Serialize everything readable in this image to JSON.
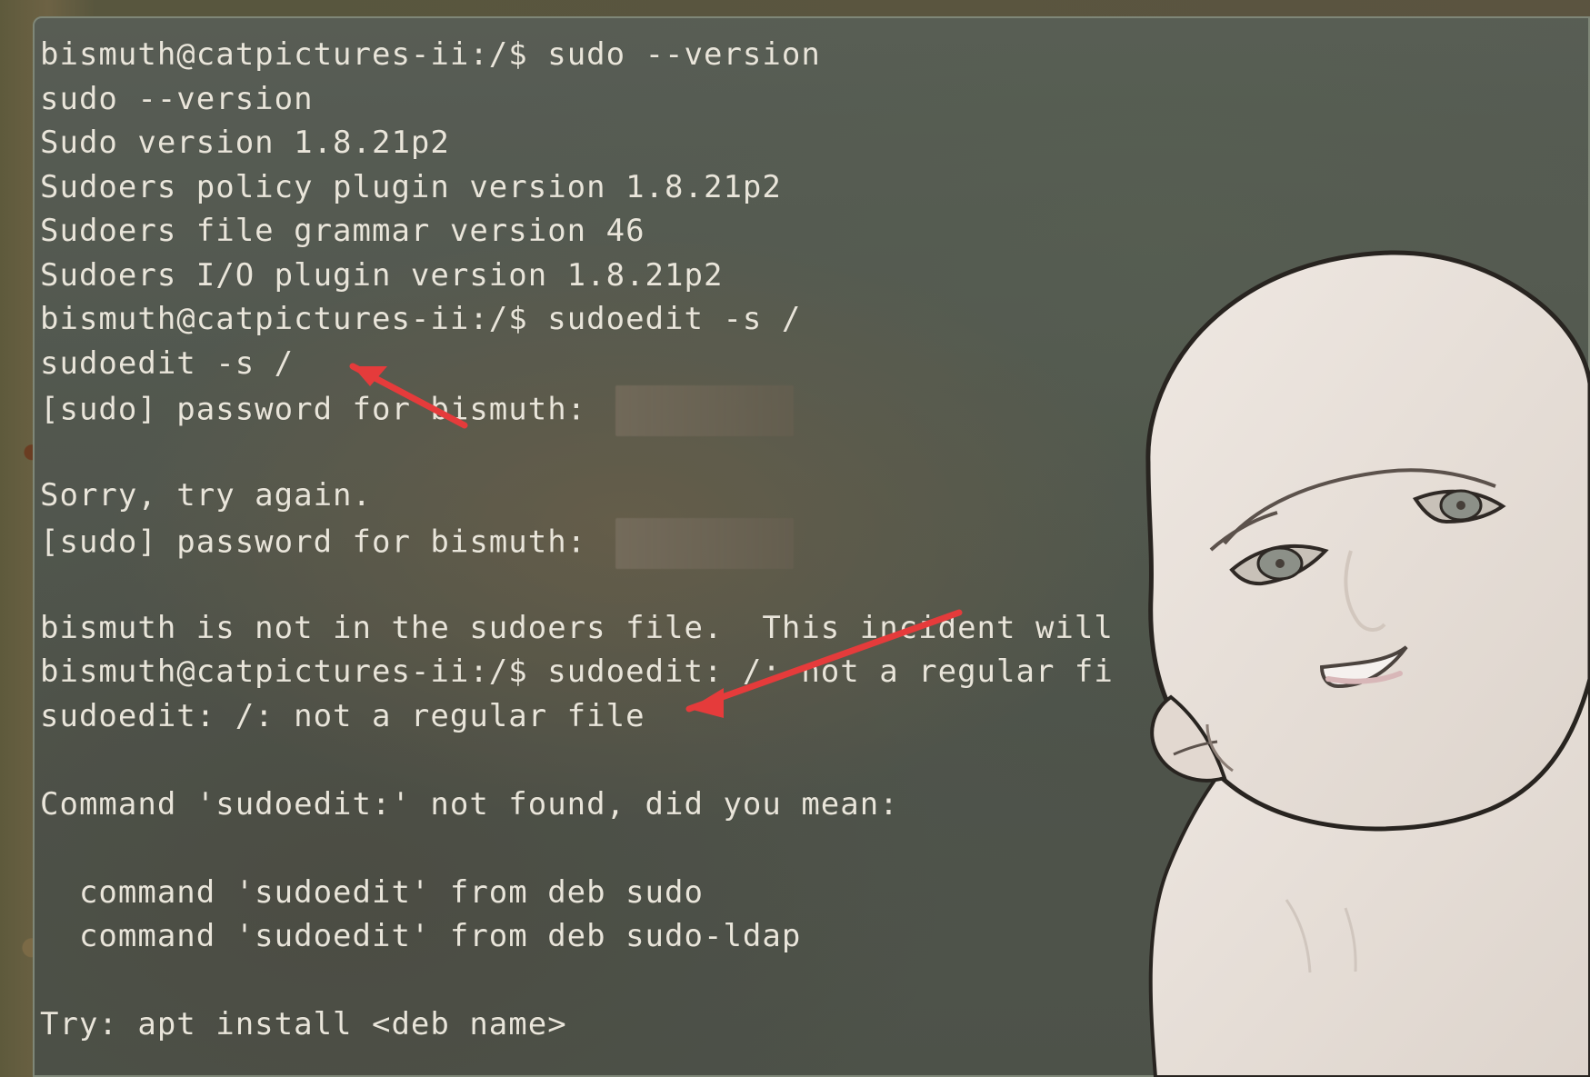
{
  "terminal": {
    "lines": [
      {
        "prompt": "bismuth@catpictures-ii:/$ ",
        "text": "sudo --version"
      },
      {
        "text": "sudo --version"
      },
      {
        "text": "Sudo version 1.8.21p2"
      },
      {
        "text": "Sudoers policy plugin version 1.8.21p2"
      },
      {
        "text": "Sudoers file grammar version 46"
      },
      {
        "text": "Sudoers I/O plugin version 1.8.21p2"
      },
      {
        "prompt": "bismuth@catpictures-ii:/$ ",
        "text": "sudoedit -s /"
      },
      {
        "text": "sudoedit -s /"
      },
      {
        "text": "[sudo] password for bismuth: "
      },
      {
        "text": ""
      },
      {
        "text": "Sorry, try again."
      },
      {
        "text": "[sudo] password for bismuth: "
      },
      {
        "text": ""
      },
      {
        "text": "bismuth is not in the sudoers file.  This incident will"
      },
      {
        "prompt": "bismuth@catpictures-ii:/$ ",
        "text": "sudoedit: /: not a regular fi"
      },
      {
        "text": "sudoedit: /: not a regular file"
      },
      {
        "text": ""
      },
      {
        "text": "Command 'sudoedit:' not found, did you mean:"
      },
      {
        "text": ""
      },
      {
        "text": "  command 'sudoedit' from deb sudo"
      },
      {
        "text": "  command 'sudoedit' from deb sudo-ldap"
      },
      {
        "text": ""
      },
      {
        "text": "Try: apt install <deb name>"
      }
    ]
  },
  "overlay": {
    "arrow_color": "#e53b3b",
    "avatar_icon": "bald-avatar-illustration-icon"
  }
}
